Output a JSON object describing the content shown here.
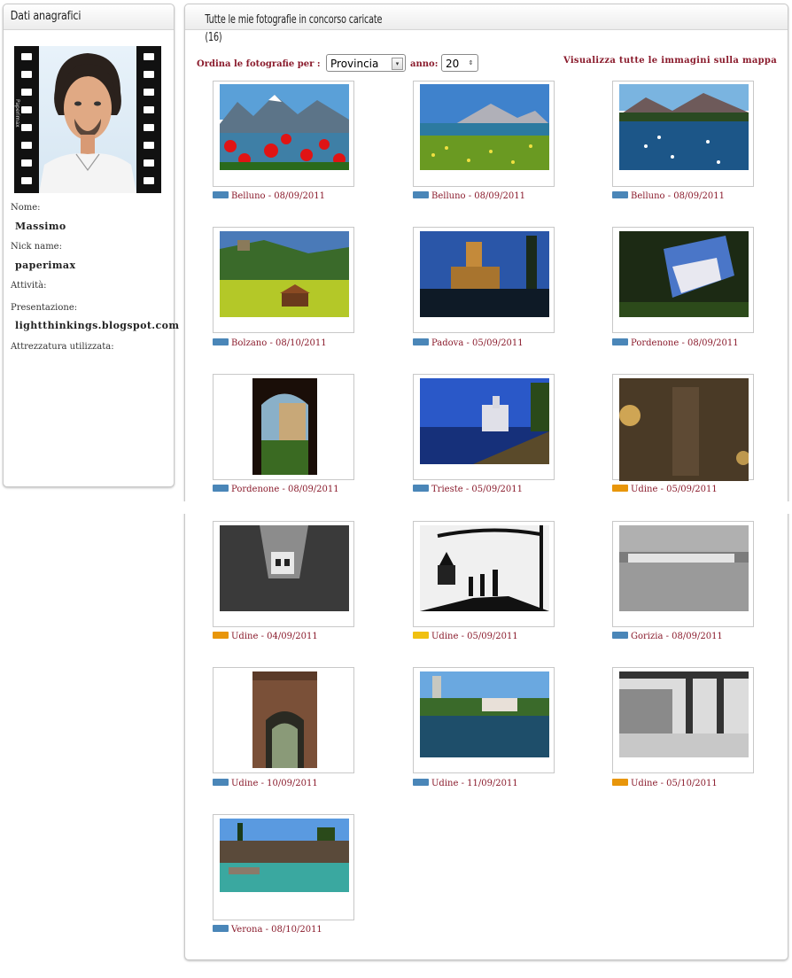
{
  "profile": {
    "title": "Dati anagrafici",
    "avatar_film_text": "Paperimax",
    "fields": [
      {
        "label": "Nome:",
        "value": "Massimo"
      },
      {
        "label": "Nick name:",
        "value": "paperimax"
      },
      {
        "label": "Attività:",
        "value": ""
      },
      {
        "label": "Presentazione:",
        "value": "lightthinkings.blogspot.com"
      },
      {
        "label": "Attrezzatura utilizzata:",
        "value": ""
      }
    ]
  },
  "gallery": {
    "title": "Tutte le mie fotografie in concorso caricate",
    "count": "(16)",
    "sort_label": "Ordina le fotografie per :",
    "sort_value": "Provincia",
    "year_label": "anno:",
    "year_value": "20",
    "map_link": "Visualizza tutte le immagini sulla mappa",
    "photos": [
      {
        "caption": "Belluno - 08/09/2011",
        "flag_color": "#4a86b8"
      },
      {
        "caption": "Belluno - 08/09/2011",
        "flag_color": "#4a86b8"
      },
      {
        "caption": "Belluno - 08/09/2011",
        "flag_color": "#4a86b8"
      },
      {
        "caption": "Bolzano - 08/10/2011",
        "flag_color": "#4a86b8"
      },
      {
        "caption": "Padova - 05/09/2011",
        "flag_color": "#4a86b8"
      },
      {
        "caption": "Pordenone - 08/09/2011",
        "flag_color": "#4a86b8"
      },
      {
        "caption": "Pordenone - 08/09/2011",
        "flag_color": "#4a86b8"
      },
      {
        "caption": "Trieste - 05/09/2011",
        "flag_color": "#4a86b8"
      },
      {
        "caption": "Udine - 05/09/2011",
        "flag_color": "#e8960a"
      },
      {
        "caption": "Udine - 04/09/2011",
        "flag_color": "#e8960a"
      },
      {
        "caption": "Udine - 05/09/2011",
        "flag_color": "#f0c010"
      },
      {
        "caption": "Gorizia - 08/09/2011",
        "flag_color": "#4a86b8"
      },
      {
        "caption": "Udine - 10/09/2011",
        "flag_color": "#4a86b8"
      },
      {
        "caption": "Udine - 11/09/2011",
        "flag_color": "#4a86b8"
      },
      {
        "caption": "Udine - 05/10/2011",
        "flag_color": "#e8960a"
      },
      {
        "caption": "Verona - 08/10/2011",
        "flag_color": "#4a86b8"
      }
    ]
  }
}
